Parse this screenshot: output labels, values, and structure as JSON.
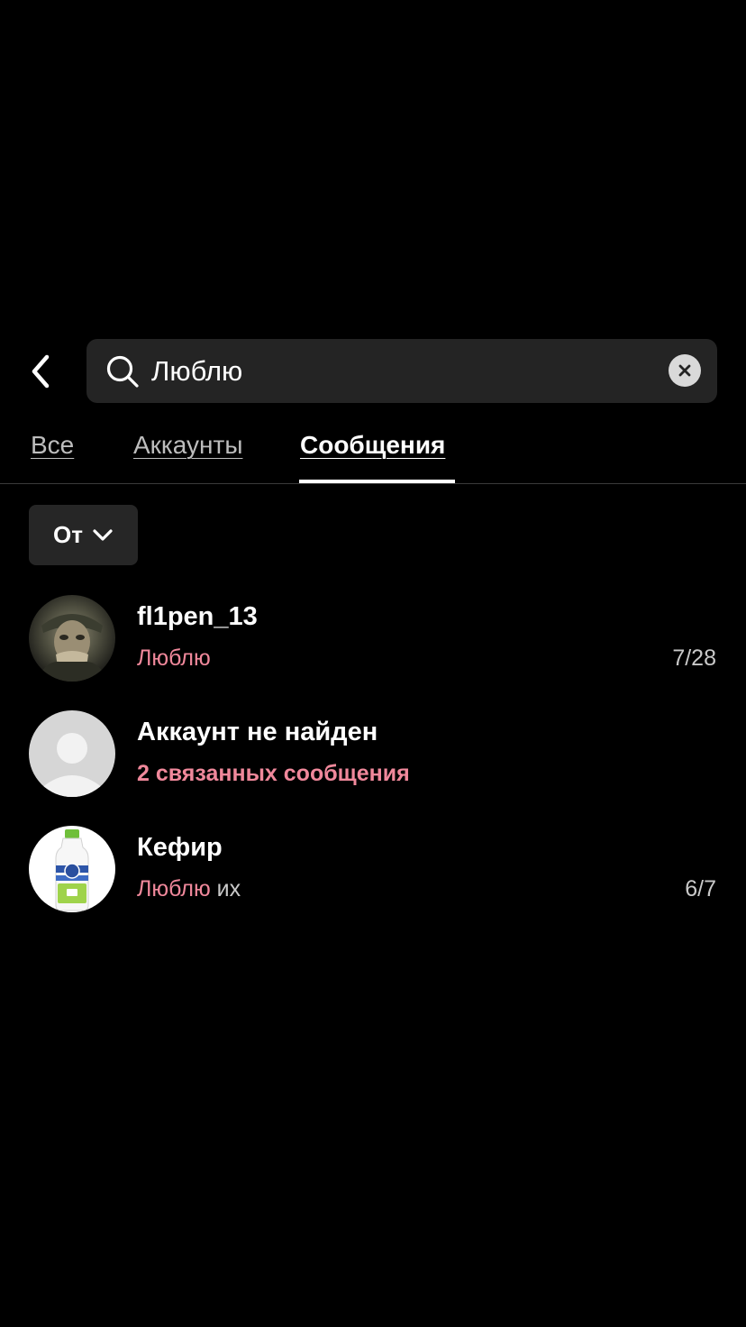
{
  "search": {
    "query": "Люблю"
  },
  "tabs": [
    {
      "label": "Все",
      "active": false
    },
    {
      "label": "Аккаунты",
      "active": false
    },
    {
      "label": "Сообщения",
      "active": true
    }
  ],
  "filter": {
    "label": "От"
  },
  "results": [
    {
      "name": "fl1pen_13",
      "snippet_highlight": "Люблю",
      "snippet_rest": "",
      "count": "7/28",
      "avatar": "soldier-photo"
    },
    {
      "name": "Аккаунт не найден",
      "linked_messages": "2 связанных сообщения",
      "avatar": "default-user-avatar"
    },
    {
      "name": "Кефир",
      "snippet_highlight": "Люблю",
      "snippet_rest": " их",
      "count": "6/7",
      "avatar": "kefir-bottle-photo"
    }
  ],
  "colors": {
    "background": "#000000",
    "search_bg": "#242424",
    "highlight": "#f0889b",
    "secondary_text": "#c9c9c9",
    "chip_bg": "#262626"
  }
}
